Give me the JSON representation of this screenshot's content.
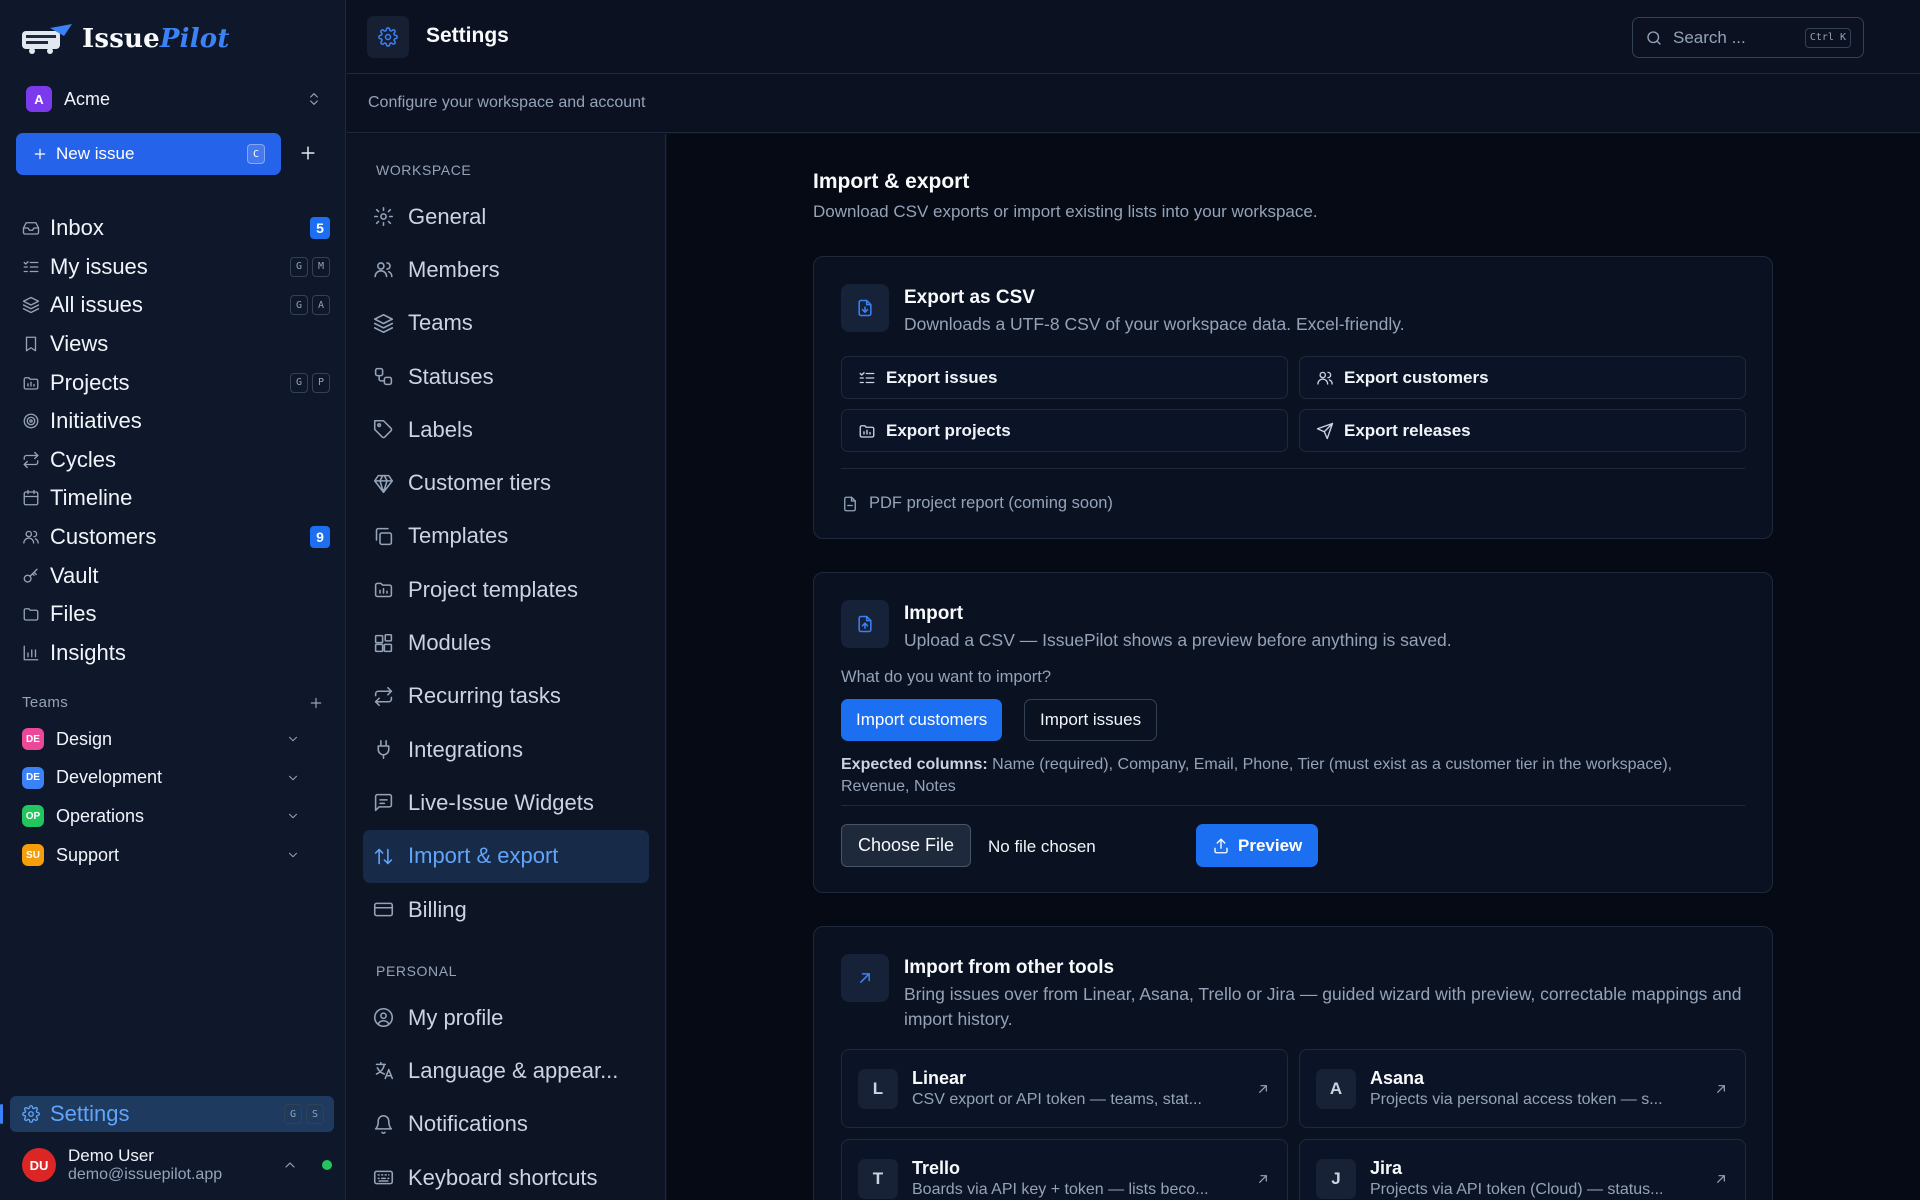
{
  "app": {
    "name_part1": "Issue",
    "name_part2": "Pilot",
    "workspace": {
      "initial": "A",
      "name": "Acme"
    },
    "new_issue": {
      "label": "New issue",
      "shortcut": "C"
    }
  },
  "sidebar": {
    "nav": [
      {
        "label": "Inbox",
        "icon": "inbox-icon",
        "badge": "5",
        "keys": []
      },
      {
        "label": "My issues",
        "icon": "list-check-icon",
        "badge": "",
        "keys": [
          "G",
          "M"
        ]
      },
      {
        "label": "All issues",
        "icon": "layers-icon",
        "badge": "",
        "keys": [
          "G",
          "A"
        ]
      },
      {
        "label": "Views",
        "icon": "bookmark-icon",
        "badge": "",
        "keys": []
      },
      {
        "label": "Projects",
        "icon": "folder-chart-icon",
        "badge": "",
        "keys": [
          "G",
          "P"
        ]
      },
      {
        "label": "Initiatives",
        "icon": "target-icon",
        "badge": "",
        "keys": []
      },
      {
        "label": "Cycles",
        "icon": "repeat-icon",
        "badge": "",
        "keys": []
      },
      {
        "label": "Timeline",
        "icon": "calendar-icon",
        "badge": "",
        "keys": []
      },
      {
        "label": "Customers",
        "icon": "users-icon",
        "badge": "9",
        "keys": []
      },
      {
        "label": "Vault",
        "icon": "key-icon",
        "badge": "",
        "keys": []
      },
      {
        "label": "Files",
        "icon": "folder-icon",
        "badge": "",
        "keys": []
      },
      {
        "label": "Insights",
        "icon": "bar-chart-icon",
        "badge": "",
        "keys": []
      }
    ],
    "teams_label": "Teams",
    "teams": [
      {
        "initials": "DE",
        "name": "Design",
        "color": "#ec4899"
      },
      {
        "initials": "DE",
        "name": "Development",
        "color": "#3b82f6"
      },
      {
        "initials": "OP",
        "name": "Operations",
        "color": "#22c55e"
      },
      {
        "initials": "SU",
        "name": "Support",
        "color": "#f59e0b"
      }
    ],
    "settings": {
      "label": "Settings",
      "keys": [
        "G",
        "S"
      ]
    },
    "user": {
      "initials": "DU",
      "name": "Demo User",
      "email": "demo@issuepilot.app"
    }
  },
  "header": {
    "title": "Settings",
    "subtitle": "Configure your workspace and account",
    "search": {
      "placeholder": "Search ...",
      "shortcut": "Ctrl K"
    }
  },
  "settings_nav": {
    "workspace_label": "WORKSPACE",
    "workspace_items": [
      {
        "label": "General",
        "icon": "gear-icon"
      },
      {
        "label": "Members",
        "icon": "users-icon"
      },
      {
        "label": "Teams",
        "icon": "layers-icon"
      },
      {
        "label": "Statuses",
        "icon": "workflow-icon"
      },
      {
        "label": "Labels",
        "icon": "tag-icon"
      },
      {
        "label": "Customer tiers",
        "icon": "gem-icon"
      },
      {
        "label": "Templates",
        "icon": "copy-icon"
      },
      {
        "label": "Project templates",
        "icon": "folder-chart-icon"
      },
      {
        "label": "Modules",
        "icon": "blocks-icon"
      },
      {
        "label": "Recurring tasks",
        "icon": "repeat-icon"
      },
      {
        "label": "Integrations",
        "icon": "plug-icon"
      },
      {
        "label": "Live-Issue Widgets",
        "icon": "message-icon"
      },
      {
        "label": "Import & export",
        "icon": "arrows-updown-icon",
        "active": true
      },
      {
        "label": "Billing",
        "icon": "credit-card-icon"
      }
    ],
    "personal_label": "PERSONAL",
    "personal_items": [
      {
        "label": "My profile",
        "icon": "user-circle-icon"
      },
      {
        "label": "Language & appear...",
        "icon": "translate-icon"
      },
      {
        "label": "Notifications",
        "icon": "bell-icon"
      },
      {
        "label": "Keyboard shortcuts",
        "icon": "keyboard-icon"
      }
    ]
  },
  "main": {
    "title": "Import & export",
    "subtitle": "Download CSV exports or import existing lists into your workspace.",
    "export": {
      "title": "Export as CSV",
      "desc": "Downloads a UTF-8 CSV of your workspace data. Excel-friendly.",
      "buttons": [
        {
          "label": "Export issues",
          "icon": "list-check-icon"
        },
        {
          "label": "Export customers",
          "icon": "users-icon"
        },
        {
          "label": "Export projects",
          "icon": "folder-chart-icon"
        },
        {
          "label": "Export releases",
          "icon": "send-icon"
        }
      ],
      "pdf_note": "PDF project report (coming soon)"
    },
    "import": {
      "title": "Import",
      "desc": "Upload a CSV — IssuePilot shows a preview before anything is saved.",
      "question": "What do you want to import?",
      "options": [
        "Import customers",
        "Import issues"
      ],
      "selected": "Import customers",
      "columns_label": "Expected columns:",
      "columns_text": " Name (required), Company, Email, Phone, Tier (must exist as a customer tier in the workspace), Revenue, Notes",
      "file_button": "Choose File",
      "file_status": "No file chosen",
      "preview_button": "Preview"
    },
    "tools": {
      "title": "Import from other tools",
      "desc": "Bring issues over from Linear, Asana, Trello or Jira — guided wizard with preview, correctable mappings and import history.",
      "items": [
        {
          "letter": "L",
          "name": "Linear",
          "desc": "CSV export or API token — teams, stat..."
        },
        {
          "letter": "A",
          "name": "Asana",
          "desc": "Projects via personal access token — s..."
        },
        {
          "letter": "T",
          "name": "Trello",
          "desc": "Boards via API key + token — lists beco..."
        },
        {
          "letter": "J",
          "name": "Jira",
          "desc": "Projects via API token (Cloud) — status..."
        }
      ]
    }
  },
  "colors": {
    "accent": "#1d6ff2",
    "active_text": "#60a5fa",
    "background": "#0b1120"
  }
}
